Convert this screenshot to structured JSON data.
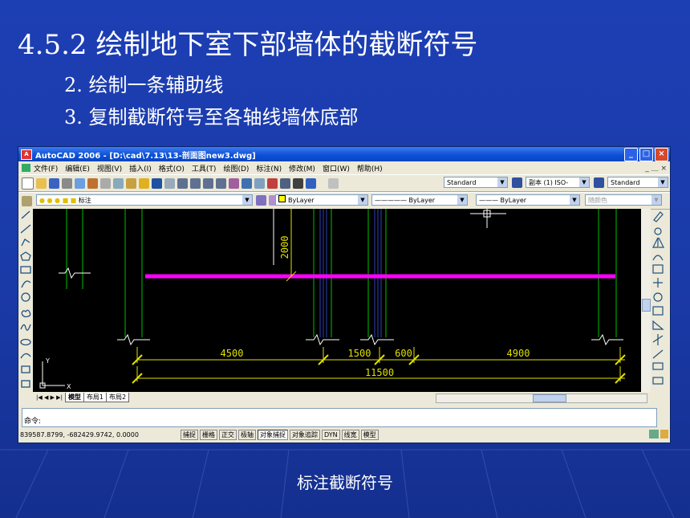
{
  "slide": {
    "title": "4.5.2 绘制地下室下部墙体的截断符号",
    "bullets": [
      "2. 绘制一条辅助线",
      "3. 复制截断符号至各轴线墙体底部"
    ],
    "caption": "标注截断符号"
  },
  "window": {
    "title": "AutoCAD 2006 - [D:\\cad\\7.13\\13-剖面图new3.dwg]",
    "controls": [
      "_",
      "□",
      "×"
    ]
  },
  "menu": [
    "文件(F)",
    "编辑(E)",
    "视图(V)",
    "插入(I)",
    "格式(O)",
    "工具(T)",
    "绘图(D)",
    "标注(N)",
    "修改(M)",
    "窗口(W)",
    "帮助(H)"
  ],
  "menu_right": "_ ＿ ×",
  "toolbar": {
    "text_style": "Standard",
    "dim_style": "副本 (1) ISO-",
    "table_style": "Standard"
  },
  "layers": {
    "current_layer": "标注",
    "color": "ByLayer",
    "linetype": "ByLayer",
    "lineweight": "ByLayer",
    "plot_style": "随颜色"
  },
  "drawing": {
    "dim_vertical": "2000",
    "dims_row1": [
      "4500",
      "1500",
      "600",
      "4900"
    ],
    "dim_total": "11500",
    "ucs_y": "Y",
    "ucs_x": "X"
  },
  "layout_tabs": [
    "模型",
    "布局1",
    "布局2"
  ],
  "command": {
    "prompt": "命令:"
  },
  "status": {
    "coords": "839587.8799, -682429.9742, 0.0000",
    "buttons": [
      "捕捉",
      "栅格",
      "正交",
      "极轴",
      "对象捕捉",
      "对象追踪",
      "DYN",
      "线宽",
      "模型"
    ]
  },
  "colors": {
    "background": "#1a3aa8",
    "canvas": "#000000",
    "guide_line": "#ff00ff",
    "dimension": "#e0e000",
    "wall": "#00c000"
  }
}
